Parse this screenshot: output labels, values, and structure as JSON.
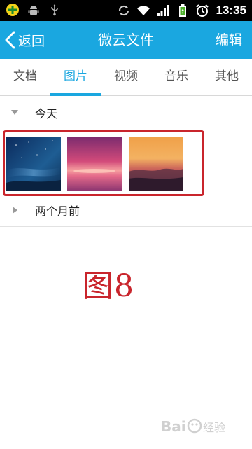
{
  "status_bar": {
    "time": "13:35",
    "icons": [
      "app-plus-icon",
      "android-icon",
      "usb-icon",
      "sync-icon",
      "wifi-icon",
      "signal-icon",
      "battery-icon",
      "alarm-icon"
    ]
  },
  "app_bar": {
    "back_label": "返回",
    "title": "微云文件",
    "edit_label": "编辑",
    "color": "#1aa7e0"
  },
  "tabs": [
    {
      "label": "文档",
      "active": false
    },
    {
      "label": "图片",
      "active": true
    },
    {
      "label": "视频",
      "active": false
    },
    {
      "label": "音乐",
      "active": false
    },
    {
      "label": "其他",
      "active": false
    }
  ],
  "sections": [
    {
      "label": "今天",
      "expanded": true,
      "thumbnails": [
        "night-sky-photo",
        "pink-sunset-photo",
        "orange-sunset-photo"
      ]
    },
    {
      "label": "两个月前",
      "expanded": false
    }
  ],
  "annotation": {
    "text": "图8",
    "color": "#c9252c"
  },
  "watermark": {
    "text": "Baidu 经验"
  }
}
